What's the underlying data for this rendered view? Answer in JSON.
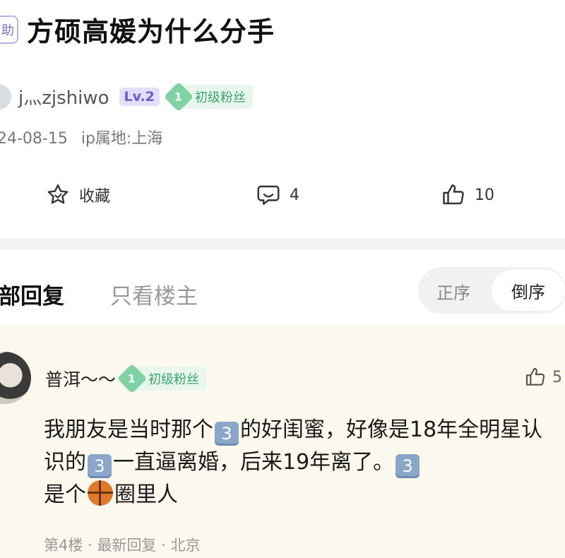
{
  "post": {
    "help_tag": "助",
    "title": "方硕高媛为什么分手",
    "author": {
      "name": "j灬zjshiwo",
      "level": "Lv.2",
      "fan_level": "1",
      "fan_label": "初级粉丝"
    },
    "date": "24-08-15",
    "ip_location": "ip属地:上海"
  },
  "actions": {
    "favorite_label": "收藏",
    "comment_count": "4",
    "like_count": "10"
  },
  "tabs": {
    "all_label": "部回复",
    "op_only_label": "只看楼主",
    "sort_asc": "正序",
    "sort_desc": "倒序"
  },
  "reply": {
    "user": "普洱～～",
    "fan_level": "1",
    "fan_label": "初级粉丝",
    "likes": "5",
    "text_1": "我朋友是当时那个",
    "emoji_1": "3",
    "text_2": "的好闺蜜，好像是18年全明星认识的",
    "emoji_2": "3",
    "text_3": "一直逼离婚，后来19年离了。",
    "emoji_3": "3",
    "text_4": "是个",
    "text_5": "圈里人",
    "floor": "第4楼",
    "latest": "最新回复",
    "location": "北京",
    "sep": "·"
  },
  "colors": {
    "accent_purple": "#6c5bd4",
    "fan_green": "#3aa66b",
    "reply_bg": "#fbf8ee"
  },
  "icons": [
    "star-icon",
    "comment-icon",
    "thumbs-up-icon",
    "basketball-emoji",
    "keycap-3-emoji"
  ]
}
